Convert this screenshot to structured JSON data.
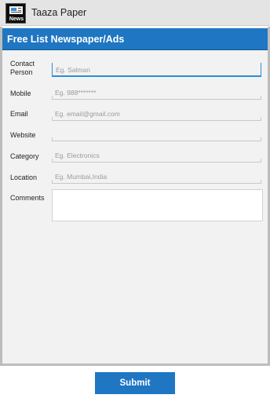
{
  "app": {
    "title": "Taaza Paper",
    "icon_text": "News",
    "icon": "newspaper-icon"
  },
  "form": {
    "header": "Free List Newspaper/Ads",
    "fields": [
      {
        "label": "Contact Person",
        "placeholder": "Eg. Salman",
        "value": ""
      },
      {
        "label": "Mobile",
        "placeholder": "Eg. 988*******",
        "value": ""
      },
      {
        "label": "Email",
        "placeholder": "Eg. email@gmail.com",
        "value": ""
      },
      {
        "label": "Website",
        "placeholder": "",
        "value": ""
      },
      {
        "label": "Category",
        "placeholder": "Eg. Electronics",
        "value": ""
      },
      {
        "label": "Location",
        "placeholder": "Eg. Mumbai,India",
        "value": ""
      },
      {
        "label": "Comments",
        "placeholder": "",
        "value": ""
      }
    ],
    "submit_label": "Submit"
  },
  "colors": {
    "accent": "#1f76c2",
    "focus": "#2a8dd8",
    "titlebar": "#e4e4e4",
    "form_background": "#f2f2f2"
  }
}
